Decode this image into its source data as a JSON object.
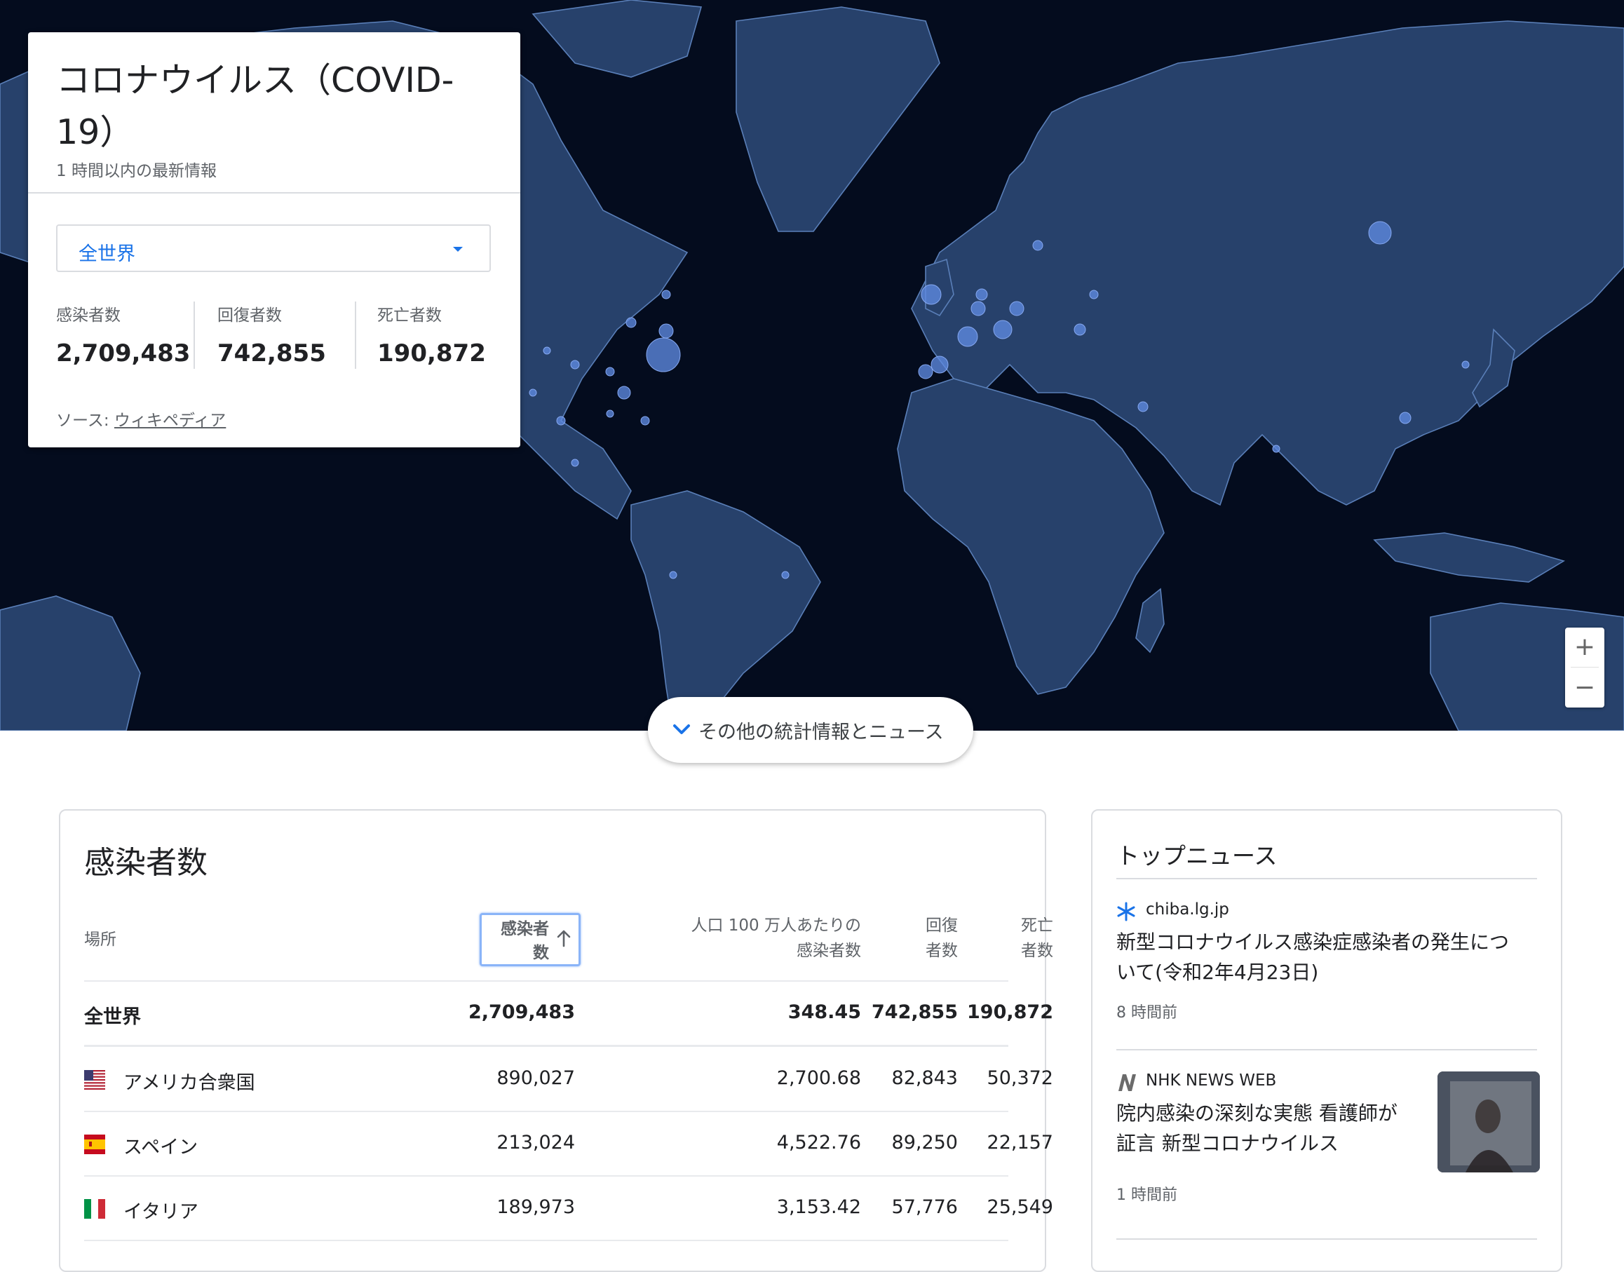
{
  "card": {
    "title": "コロナウイルス（COVID-19）",
    "updated": "1 時間以内の最新情報",
    "region": "全世界",
    "stats": [
      {
        "label": "感染者数",
        "value": "2,709,483"
      },
      {
        "label": "回復者数",
        "value": "742,855"
      },
      {
        "label": "死亡者数",
        "value": "190,872"
      }
    ],
    "source_prefix": "ソース: ",
    "source_link": "ウィキペディア"
  },
  "zoom": {
    "in": "+",
    "out": "−"
  },
  "more_button": "その他の統計情報とニュース",
  "table": {
    "title": "感染者数",
    "headers": {
      "place": "場所",
      "cases_1": "感染者",
      "cases_2": "数",
      "per_million_1": "人口 100 万人あたりの",
      "per_million_2": "感染者数",
      "recovered_1": "回復",
      "recovered_2": "者数",
      "deaths_1": "死亡",
      "deaths_2": "者数"
    },
    "rows": [
      {
        "place": "全世界",
        "cases": "2,709,483",
        "per_million": "348.45",
        "recovered": "742,855",
        "deaths": "190,872"
      },
      {
        "place": "アメリカ合衆国",
        "cases": "890,027",
        "per_million": "2,700.68",
        "recovered": "82,843",
        "deaths": "50,372",
        "flag": "us"
      },
      {
        "place": "スペイン",
        "cases": "213,024",
        "per_million": "4,522.76",
        "recovered": "89,250",
        "deaths": "22,157",
        "flag": "es"
      },
      {
        "place": "イタリア",
        "cases": "189,973",
        "per_million": "3,153.42",
        "recovered": "57,776",
        "deaths": "25,549",
        "flag": "it"
      }
    ]
  },
  "news": {
    "title": "トップニュース",
    "items": [
      {
        "source": "chiba.lg.jp",
        "headline_1": "新型コロナウイルス感染症感染者の発生につ",
        "headline_2": "いて(令和2年4月23日)",
        "time": "8 時間前"
      },
      {
        "source": "NHK NEWS WEB",
        "headline_1": "院内感染の深刻な実態 看護師が",
        "headline_2": "証言 新型コロナウイルス",
        "time": "1 時間前"
      }
    ]
  },
  "colors": {
    "accent": "#1a73e8",
    "map_bg": "#040c1e",
    "land": "#27416b",
    "bubble": "#5f8be2"
  }
}
